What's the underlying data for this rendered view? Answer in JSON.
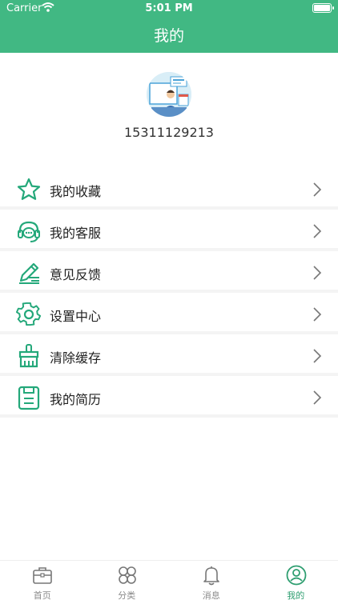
{
  "status_bar": {
    "carrier": "Carrier",
    "time": "5:01 PM"
  },
  "header": {
    "title": "我的"
  },
  "profile": {
    "phone": "15311129213"
  },
  "menu": [
    {
      "label": "我的收藏",
      "icon": "star-icon"
    },
    {
      "label": "我的客服",
      "icon": "headset-icon"
    },
    {
      "label": "意见反馈",
      "icon": "pen-icon"
    },
    {
      "label": "设置中心",
      "icon": "gear-icon"
    },
    {
      "label": "清除缓存",
      "icon": "broom-icon"
    },
    {
      "label": "我的简历",
      "icon": "document-icon"
    }
  ],
  "tabs": [
    {
      "label": "首页",
      "icon": "briefcase-icon"
    },
    {
      "label": "分类",
      "icon": "clover-icon"
    },
    {
      "label": "消息",
      "icon": "bell-icon"
    },
    {
      "label": "我的",
      "icon": "user-circle-icon",
      "active": true
    }
  ],
  "colors": {
    "primary": "#41b883",
    "icon_green": "#24a87a",
    "tab_active": "#2e9e70"
  }
}
